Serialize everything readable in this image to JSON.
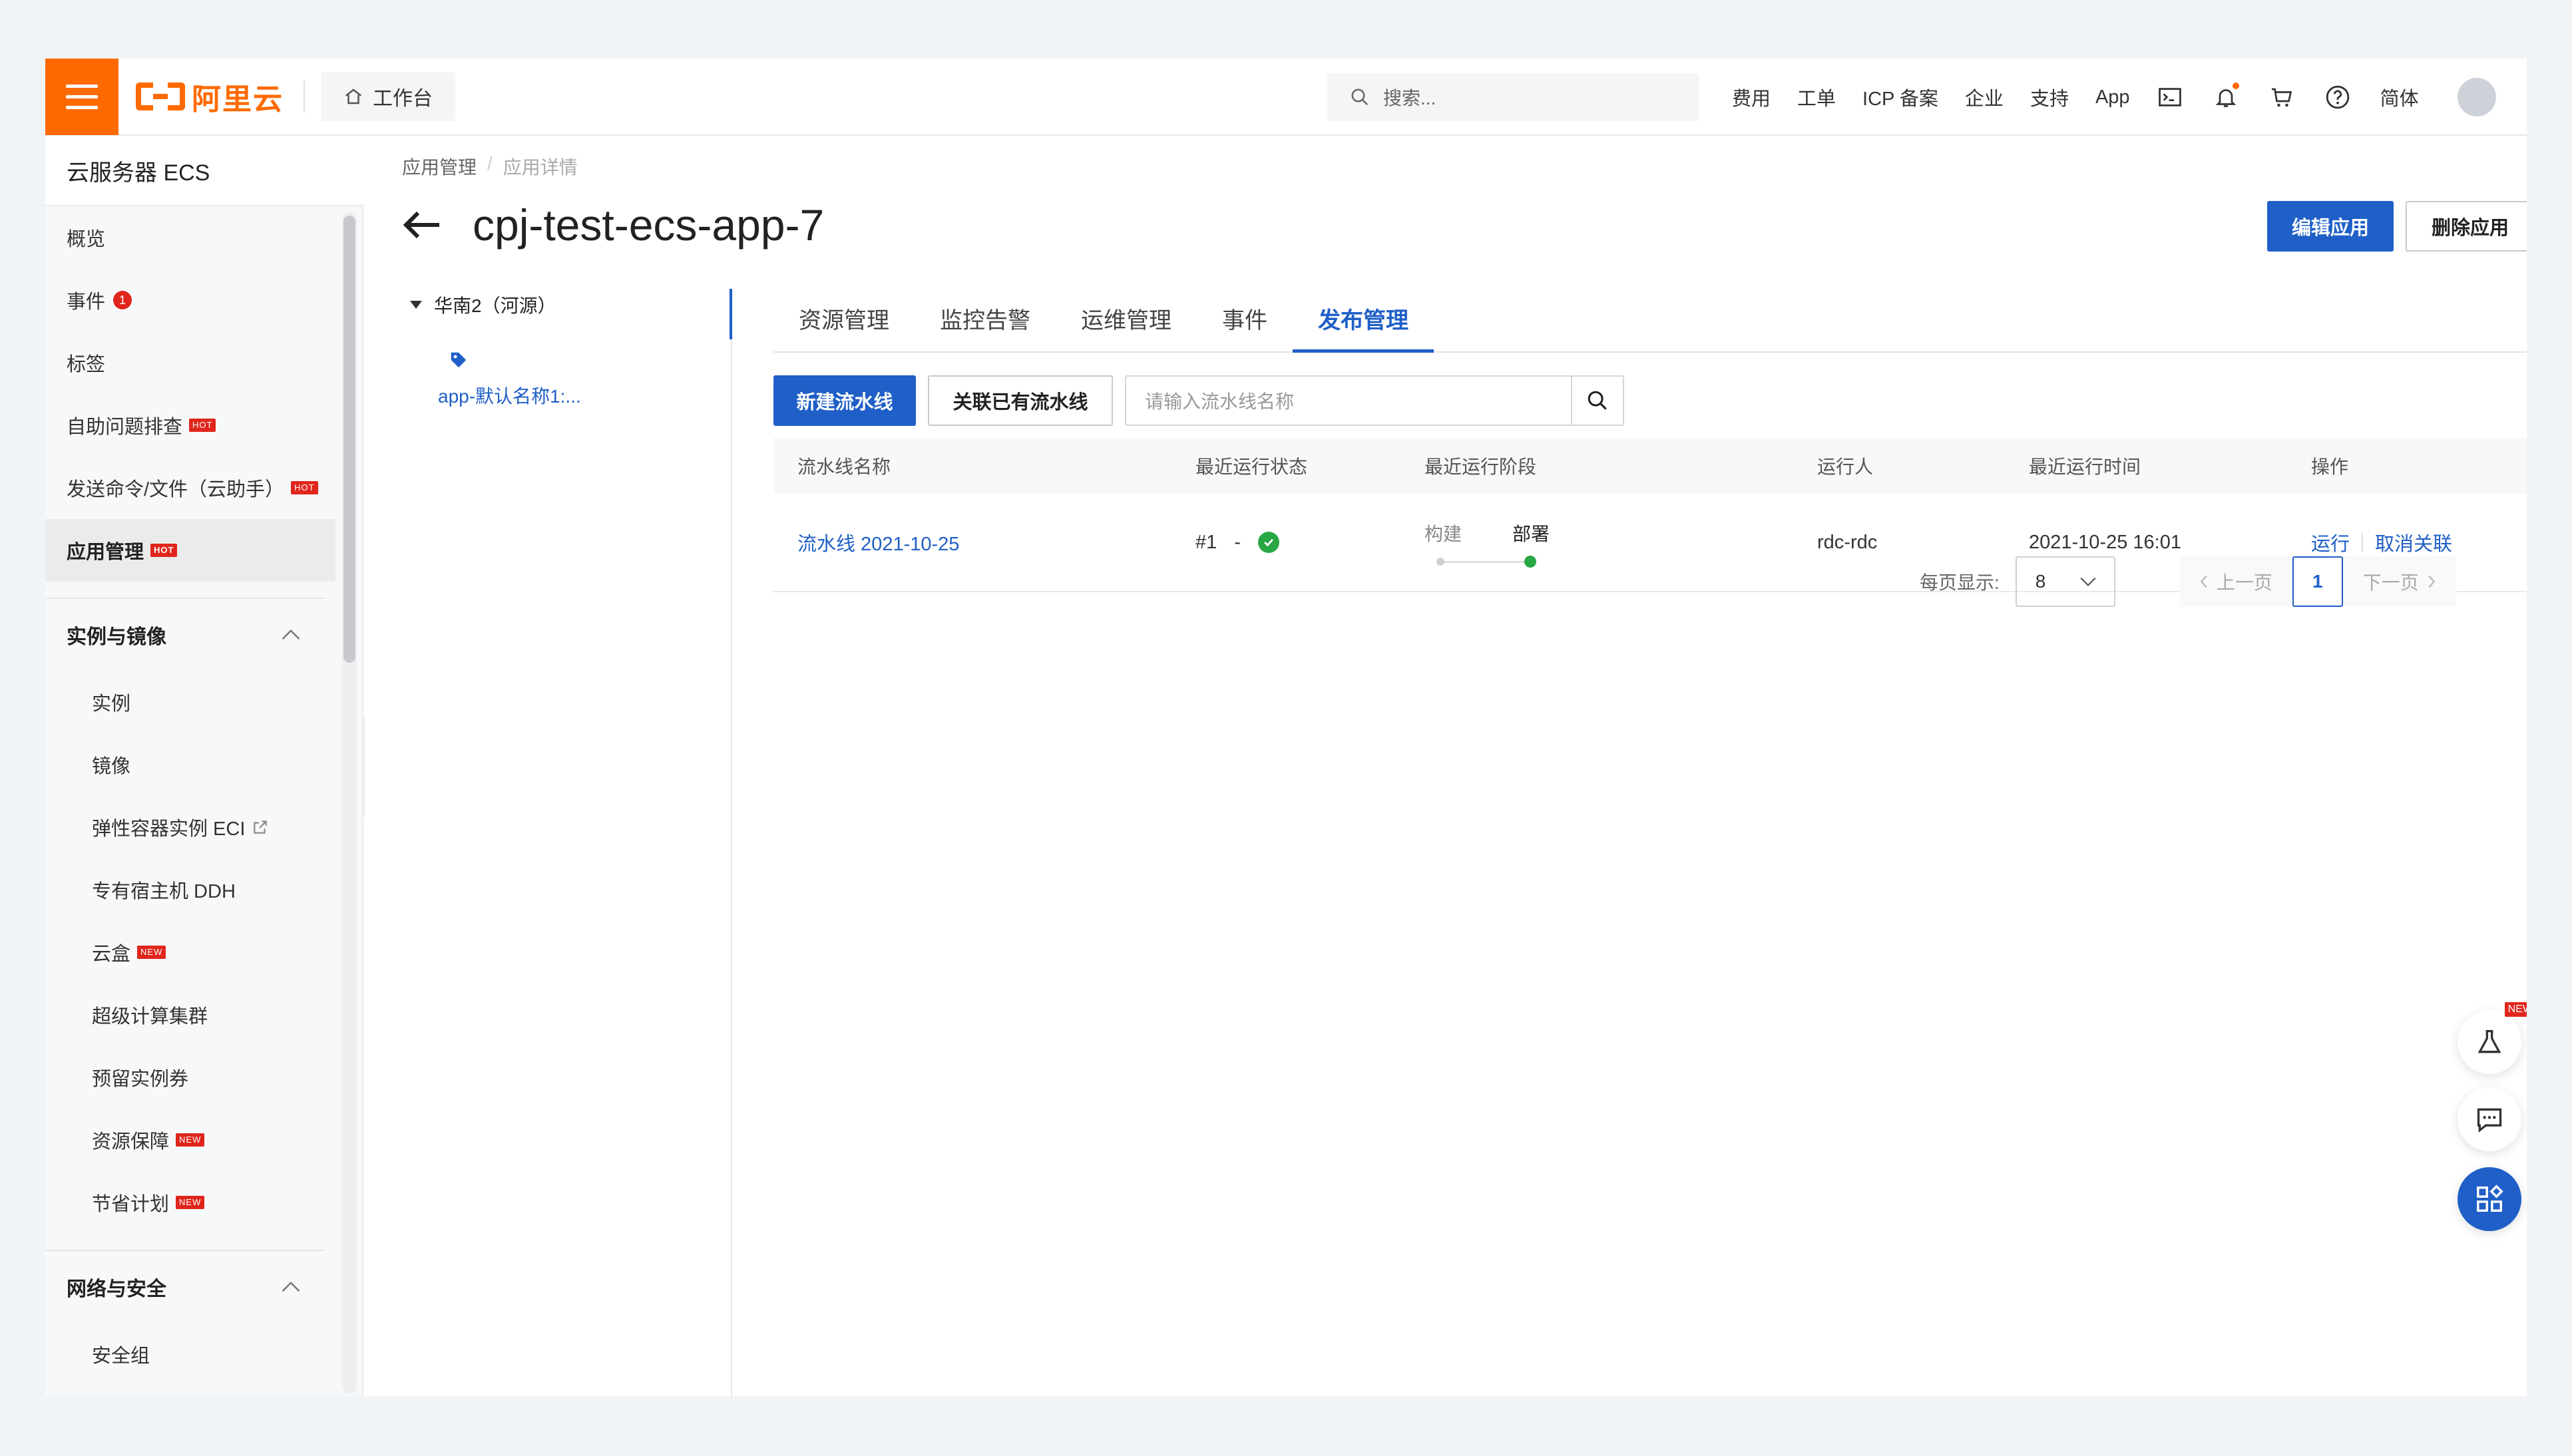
{
  "topbar": {
    "logo_text": "阿里云",
    "workbench": "工作台",
    "search_placeholder": "搜索...",
    "links": [
      "费用",
      "工单",
      "ICP 备案",
      "企业",
      "支持",
      "App"
    ],
    "lang": "简体",
    "brand_color": "#ff6a00"
  },
  "sidebar": {
    "title": "云服务器 ECS",
    "items": [
      {
        "label": "概览"
      },
      {
        "label": "事件",
        "badge": "1"
      },
      {
        "label": "标签"
      },
      {
        "label": "自助问题排查",
        "tag": "HOT"
      },
      {
        "label": "发送命令/文件（云助手）",
        "tag": "HOT"
      },
      {
        "label": "应用管理",
        "tag": "HOT"
      }
    ],
    "group1": {
      "title": "实例与镜像",
      "items": [
        {
          "label": "实例"
        },
        {
          "label": "镜像"
        },
        {
          "label": "弹性容器实例 ECI"
        },
        {
          "label": "专有宿主机 DDH"
        },
        {
          "label": "云盒",
          "tag": "NEW"
        },
        {
          "label": "超级计算集群"
        },
        {
          "label": "预留实例券"
        },
        {
          "label": "资源保障",
          "tag": "NEW"
        },
        {
          "label": "节省计划",
          "tag": "NEW"
        }
      ]
    },
    "group2": {
      "title": "网络与安全",
      "items": [
        {
          "label": "安全组"
        }
      ]
    }
  },
  "main": {
    "breadcrumb": [
      "应用管理",
      "应用详情"
    ],
    "breadcrumb_sep": "/",
    "title": "cpj-test-ecs-app-7",
    "edit_button": "编辑应用",
    "delete_button": "删除应用",
    "tree": {
      "region": "华南2（河源）",
      "leaf": "app-默认名称1:..."
    },
    "tabs": [
      "资源管理",
      "监控告警",
      "运维管理",
      "事件",
      "发布管理"
    ],
    "active_tab": "发布管理",
    "new_pipeline_button": "新建流水线",
    "link_pipeline_button": "关联已有流水线",
    "search_placeholder": "请输入流水线名称",
    "table": {
      "headers": [
        "流水线名称",
        "最近运行状态",
        "最近运行阶段",
        "运行人",
        "最近运行时间",
        "操作"
      ],
      "rows": [
        {
          "name": "流水线 2021-10-25",
          "run_no": "#1",
          "run_sep": "-",
          "stage_build": "构建",
          "stage_deploy": "部署",
          "runner": "rdc-rdc",
          "time": "2021-10-25 16:01",
          "op_run": "运行",
          "op_unlink": "取消关联"
        }
      ]
    },
    "pager": {
      "per_page_label": "每页显示:",
      "per_page_value": "8",
      "prev": "上一页",
      "current": "1",
      "next": "下一页"
    }
  },
  "float": {
    "new_label": "NEW"
  },
  "accent_color": "#1f5fc7"
}
